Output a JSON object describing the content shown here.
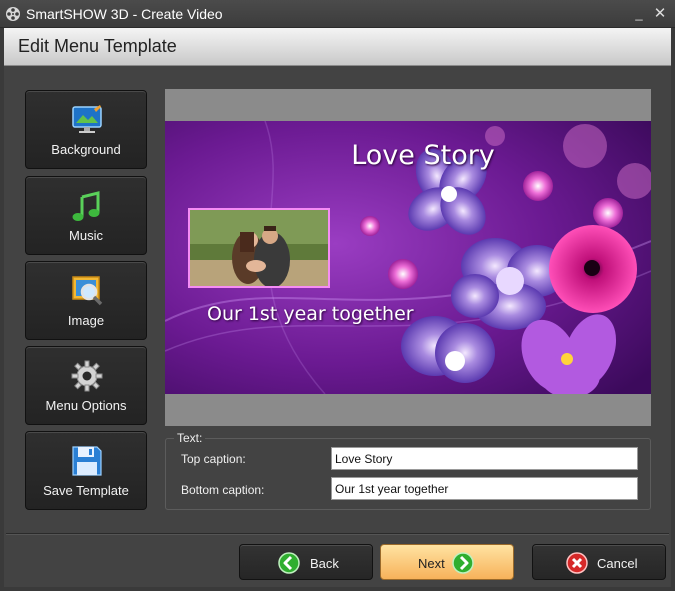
{
  "window": {
    "title": "SmartSHOW 3D - Create Video",
    "app_icon": "film-reel-icon",
    "minimize_glyph": "_",
    "close_glyph": "✕"
  },
  "header": {
    "title": "Edit Menu Template"
  },
  "sidebar": {
    "items": [
      {
        "label": "Background",
        "icon": "background-monitor-icon"
      },
      {
        "label": "Music",
        "icon": "music-notes-icon"
      },
      {
        "label": "Image",
        "icon": "image-magnifier-icon"
      },
      {
        "label": "Menu Options",
        "icon": "gear-icon"
      },
      {
        "label": "Save Template",
        "icon": "floppy-disk-icon"
      }
    ]
  },
  "preview": {
    "top_caption": "Love Story",
    "bottom_caption": "Our 1st year together"
  },
  "text_fields": {
    "legend": "Text:",
    "top_caption_label": "Top caption:",
    "top_caption_value": "Love Story",
    "bottom_caption_label": "Bottom caption:",
    "bottom_caption_value": "Our 1st year together"
  },
  "footer": {
    "back_label": "Back",
    "next_label": "Next",
    "cancel_label": "Cancel"
  },
  "colors": {
    "accent_next": "#f7b25a",
    "preview_purple": "#6a1a8c",
    "back_next_icon": "#2fae2f",
    "cancel_icon": "#d62828"
  }
}
